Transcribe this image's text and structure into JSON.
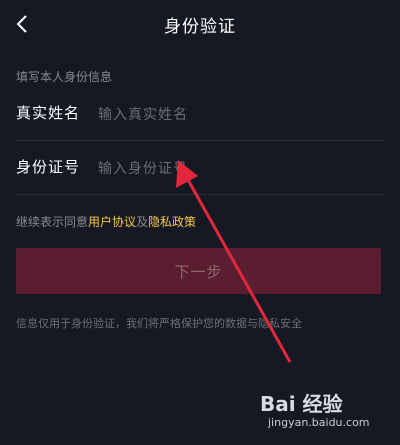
{
  "header": {
    "title": "身份验证",
    "back_icon": "chevron-left-icon"
  },
  "form": {
    "section_title": "填写本人身份信息",
    "name_label": "真实姓名",
    "name_placeholder": "输入真实姓名",
    "id_label": "身份证号",
    "id_placeholder": "输入身份证号"
  },
  "agreement": {
    "prefix": "继续表示同意",
    "user_agreement": "用户协议",
    "conjunction": "及",
    "privacy_policy": "隐私政策"
  },
  "next_button_label": "下一步",
  "privacy_note": "信息仅用于身份验证，我们将严格保护您的数据与隐私安全",
  "watermark": {
    "logo_text": "Bai 经验",
    "site": "jingyan.baidu.com"
  },
  "colors": {
    "background": "#161823",
    "link": "#f7c948",
    "button": "#5a1e30",
    "arrow": "#e3283c"
  }
}
